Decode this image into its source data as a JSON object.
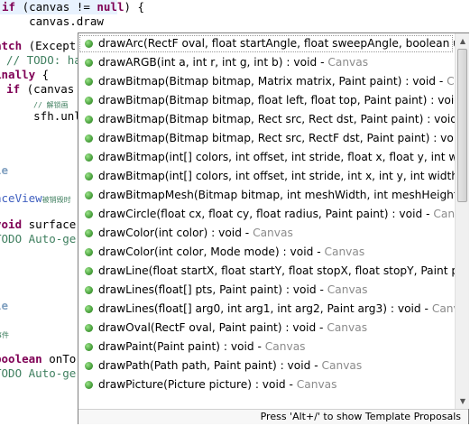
{
  "editor": {
    "lines": [
      {
        "t": "if (canvas != null) {"
      },
      {
        "t": "    canvas.draw"
      },
      {
        "t": "tch (Except"
      },
      {
        "t": "  // TODO: ha"
      },
      {
        "t": "nally {"
      },
      {
        "t": "  if (canvas"
      },
      {
        "t": "      // 解锁画"
      },
      {
        "t": "      sfh.unl"
      },
      {
        "t": "le"
      },
      {
        "t": "aceView被销毁时"
      },
      {
        "t": "void surface"
      },
      {
        "t": "TODO Auto-ge"
      },
      {
        "t": "le"
      },
      {
        "t": "事件"
      },
      {
        "t": "boolean onTo"
      },
      {
        "t": "TODO Auto-ge"
      }
    ]
  },
  "popup": {
    "items": [
      {
        "sig": "drawArc(RectF oval, float startAngle, float sweepAngle, boolean use",
        "cls": ""
      },
      {
        "sig": "drawARGB(int a, int r, int g, int b) : void - ",
        "cls": "Canvas"
      },
      {
        "sig": "drawBitmap(Bitmap bitmap, Matrix matrix, Paint paint) : void - ",
        "cls": "Canv"
      },
      {
        "sig": "drawBitmap(Bitmap bitmap, float left, float top, Paint paint) : void - ",
        "cls": ""
      },
      {
        "sig": "drawBitmap(Bitmap bitmap, Rect src, Rect dst, Paint paint) : void - ",
        "cls": ""
      },
      {
        "sig": "drawBitmap(Bitmap bitmap, Rect src, RectF dst, Paint paint) : void - ",
        "cls": ""
      },
      {
        "sig": "drawBitmap(int[] colors, int offset, int stride, float x, float y, int widtl",
        "cls": ""
      },
      {
        "sig": "drawBitmap(int[] colors, int offset, int stride, int x, int y, int width, int",
        "cls": ""
      },
      {
        "sig": "drawBitmapMesh(Bitmap bitmap, int meshWidth, int meshHeight, fl",
        "cls": ""
      },
      {
        "sig": "drawCircle(float cx, float cy, float radius, Paint paint) : void - ",
        "cls": "Canvas"
      },
      {
        "sig": "drawColor(int color) : void - ",
        "cls": "Canvas"
      },
      {
        "sig": "drawColor(int color, Mode mode) : void - ",
        "cls": "Canvas"
      },
      {
        "sig": "drawLine(float startX, float startY, float stopX, float stopY, Paint pai",
        "cls": ""
      },
      {
        "sig": "drawLines(float[] pts, Paint paint) : void - ",
        "cls": "Canvas"
      },
      {
        "sig": "drawLines(float[] arg0, int arg1, int arg2, Paint arg3) : void - ",
        "cls": "Canvas"
      },
      {
        "sig": "drawOval(RectF oval, Paint paint) : void - ",
        "cls": "Canvas"
      },
      {
        "sig": "drawPaint(Paint paint) : void - ",
        "cls": "Canvas"
      },
      {
        "sig": "drawPath(Path path, Paint paint) : void - ",
        "cls": "Canvas"
      },
      {
        "sig": "drawPicture(Picture picture) : void - ",
        "cls": "Canvas"
      }
    ],
    "selected_index": 0,
    "status_text": "Press 'Alt+/' to show Template Proposals",
    "scroll_up_icon": "arrow-up-icon",
    "scroll_down_icon": "arrow-down-icon"
  },
  "colors": {
    "keyword": "#7f0055",
    "comment": "#3f7f5f",
    "field": "#0000c0",
    "class_suffix": "#8b8b8b",
    "method_icon": "#4aa13d"
  }
}
